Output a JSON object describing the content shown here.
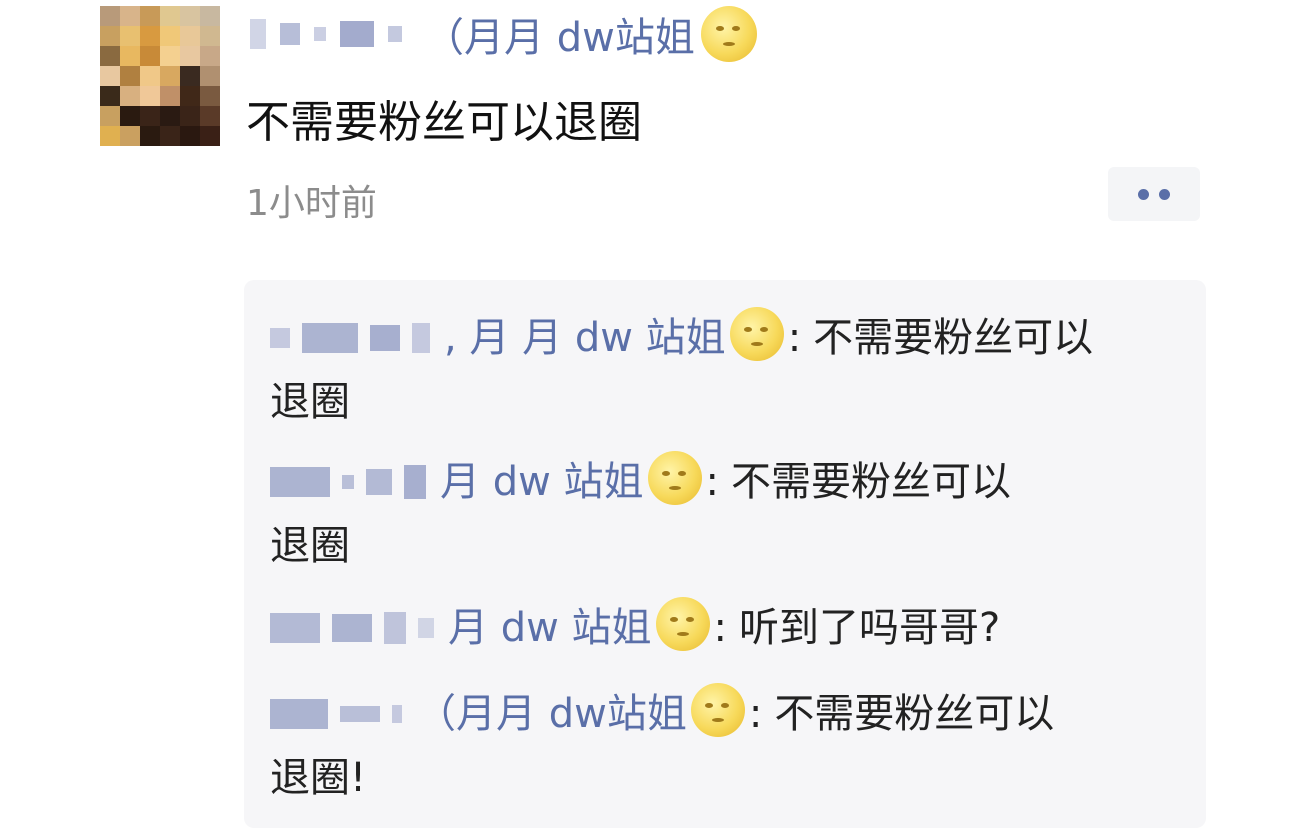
{
  "post": {
    "author_name": "（月月 dw站姐",
    "author_emoji": "moon-face-emoji",
    "text": "不需要粉丝可以退圈",
    "time": "1小时前"
  },
  "comments": [
    {
      "author": "月月 dw站姐",
      "author_display": ", 月 月 dw 站姐",
      "separator": ":",
      "text_line1": "不需要粉丝可以",
      "text_line2": "退圈"
    },
    {
      "author": "月月 dw站姐",
      "author_display": "月 dw 站姐",
      "separator": ":",
      "text_line1": "不需要粉丝可以",
      "text_line2": "退圈"
    },
    {
      "author": "月月 dw站姐",
      "author_display": "月 dw 站姐",
      "separator": ":",
      "text_line1": "听到了吗哥哥?",
      "text_line2": ""
    },
    {
      "author": "（月月 dw站姐",
      "author_display": "（月月 dw站姐",
      "separator": ":",
      "text_line1": "不需要粉丝可以",
      "text_line2": "退圈!"
    }
  ],
  "colors": {
    "name_blue": "#5a6fa8",
    "comment_bg": "#f6f6f8",
    "time_gray": "#8c8c8c",
    "moon_yellow": "#f7d95a"
  },
  "icons": {
    "more": "more-dots-icon",
    "avatar": "avatar-pixelated"
  }
}
